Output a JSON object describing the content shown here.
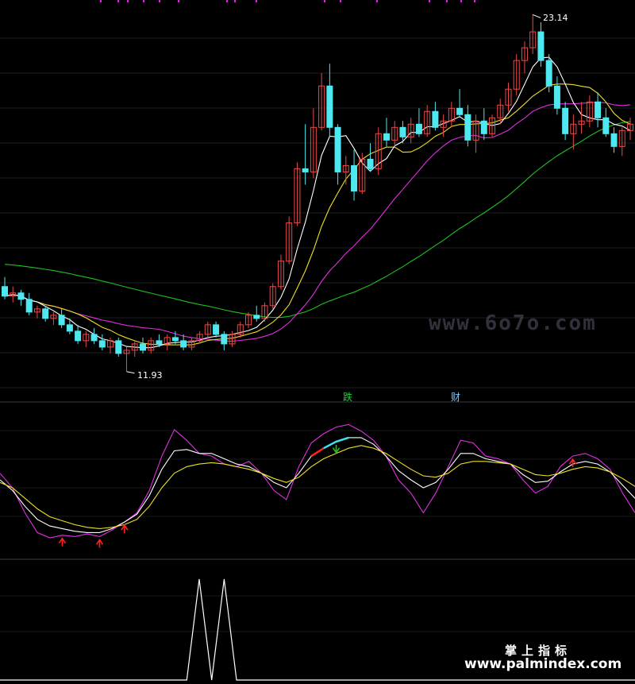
{
  "chart_data": [
    {
      "type": "candlestick",
      "annotations": {
        "high_label": "23.14",
        "low_label": "11.93",
        "event_labels": [
          "跌",
          "财"
        ]
      },
      "colors": {
        "up": "#e84a4a",
        "down": "#4fe8f0",
        "ma_fast": "#ffffff",
        "ma_mid": "#f0e020",
        "ma_slow": "#e030e0",
        "ma_long": "#20c020"
      },
      "ylim": [
        11.5,
        23.5
      ],
      "candles": [
        {
          "o": 14.6,
          "h": 14.9,
          "l": 14.2,
          "c": 14.3
        },
        {
          "o": 14.3,
          "h": 14.6,
          "l": 14.1,
          "c": 14.4
        },
        {
          "o": 14.4,
          "h": 14.5,
          "l": 14.0,
          "c": 14.2
        },
        {
          "o": 14.2,
          "h": 14.4,
          "l": 13.7,
          "c": 13.8
        },
        {
          "o": 13.8,
          "h": 14.0,
          "l": 13.6,
          "c": 13.9
        },
        {
          "o": 13.9,
          "h": 14.0,
          "l": 13.5,
          "c": 13.6
        },
        {
          "o": 13.6,
          "h": 13.8,
          "l": 13.4,
          "c": 13.7
        },
        {
          "o": 13.7,
          "h": 13.9,
          "l": 13.3,
          "c": 13.4
        },
        {
          "o": 13.4,
          "h": 13.6,
          "l": 13.1,
          "c": 13.2
        },
        {
          "o": 13.2,
          "h": 13.4,
          "l": 12.8,
          "c": 12.9
        },
        {
          "o": 12.9,
          "h": 13.2,
          "l": 12.7,
          "c": 13.1
        },
        {
          "o": 13.1,
          "h": 13.3,
          "l": 12.8,
          "c": 12.9
        },
        {
          "o": 12.9,
          "h": 13.1,
          "l": 12.6,
          "c": 12.7
        },
        {
          "o": 12.7,
          "h": 13.0,
          "l": 12.5,
          "c": 12.9
        },
        {
          "o": 12.9,
          "h": 13.0,
          "l": 12.4,
          "c": 12.5
        },
        {
          "o": 12.5,
          "h": 12.7,
          "l": 11.93,
          "c": 12.6
        },
        {
          "o": 12.6,
          "h": 12.9,
          "l": 12.4,
          "c": 12.8
        },
        {
          "o": 12.8,
          "h": 13.0,
          "l": 12.5,
          "c": 12.6
        },
        {
          "o": 12.6,
          "h": 13.0,
          "l": 12.5,
          "c": 12.9
        },
        {
          "o": 12.9,
          "h": 13.1,
          "l": 12.7,
          "c": 12.8
        },
        {
          "o": 12.8,
          "h": 13.1,
          "l": 12.6,
          "c": 13.0
        },
        {
          "o": 13.0,
          "h": 13.2,
          "l": 12.8,
          "c": 12.9
        },
        {
          "o": 12.9,
          "h": 13.1,
          "l": 12.6,
          "c": 12.7
        },
        {
          "o": 12.7,
          "h": 13.0,
          "l": 12.6,
          "c": 12.9
        },
        {
          "o": 12.9,
          "h": 13.2,
          "l": 12.8,
          "c": 13.1
        },
        {
          "o": 13.1,
          "h": 13.5,
          "l": 13.0,
          "c": 13.4
        },
        {
          "o": 13.4,
          "h": 13.5,
          "l": 13.0,
          "c": 13.1
        },
        {
          "o": 13.1,
          "h": 13.2,
          "l": 12.6,
          "c": 12.8
        },
        {
          "o": 12.8,
          "h": 13.2,
          "l": 12.7,
          "c": 13.1
        },
        {
          "o": 13.1,
          "h": 13.5,
          "l": 13.0,
          "c": 13.4
        },
        {
          "o": 13.4,
          "h": 13.8,
          "l": 13.3,
          "c": 13.7
        },
        {
          "o": 13.7,
          "h": 14.0,
          "l": 13.5,
          "c": 13.6
        },
        {
          "o": 13.6,
          "h": 14.1,
          "l": 13.5,
          "c": 14.0
        },
        {
          "o": 14.0,
          "h": 14.7,
          "l": 13.9,
          "c": 14.6
        },
        {
          "o": 14.6,
          "h": 15.6,
          "l": 14.5,
          "c": 15.4
        },
        {
          "o": 15.4,
          "h": 16.8,
          "l": 15.3,
          "c": 16.6
        },
        {
          "o": 16.6,
          "h": 18.5,
          "l": 16.5,
          "c": 18.3
        },
        {
          "o": 18.3,
          "h": 19.7,
          "l": 17.8,
          "c": 18.2
        },
        {
          "o": 18.2,
          "h": 20.2,
          "l": 18.0,
          "c": 19.6
        },
        {
          "o": 19.6,
          "h": 21.3,
          "l": 19.5,
          "c": 20.9
        },
        {
          "o": 20.9,
          "h": 21.6,
          "l": 19.3,
          "c": 19.6
        },
        {
          "o": 19.6,
          "h": 19.7,
          "l": 17.8,
          "c": 18.2
        },
        {
          "o": 18.2,
          "h": 18.7,
          "l": 17.8,
          "c": 18.4
        },
        {
          "o": 18.4,
          "h": 18.9,
          "l": 17.3,
          "c": 17.6
        },
        {
          "o": 17.6,
          "h": 18.8,
          "l": 17.5,
          "c": 18.6
        },
        {
          "o": 18.6,
          "h": 19.1,
          "l": 18.2,
          "c": 18.3
        },
        {
          "o": 18.3,
          "h": 19.6,
          "l": 18.1,
          "c": 19.4
        },
        {
          "o": 19.4,
          "h": 19.9,
          "l": 19.0,
          "c": 19.2
        },
        {
          "o": 19.2,
          "h": 19.8,
          "l": 19.0,
          "c": 19.6
        },
        {
          "o": 19.6,
          "h": 19.8,
          "l": 19.1,
          "c": 19.3
        },
        {
          "o": 19.3,
          "h": 19.9,
          "l": 19.1,
          "c": 19.7
        },
        {
          "o": 19.7,
          "h": 20.2,
          "l": 19.3,
          "c": 19.4
        },
        {
          "o": 19.4,
          "h": 20.3,
          "l": 19.3,
          "c": 20.1
        },
        {
          "o": 20.1,
          "h": 20.4,
          "l": 19.5,
          "c": 19.6
        },
        {
          "o": 19.6,
          "h": 20.0,
          "l": 19.3,
          "c": 19.8
        },
        {
          "o": 19.8,
          "h": 20.4,
          "l": 19.6,
          "c": 20.2
        },
        {
          "o": 20.2,
          "h": 20.8,
          "l": 19.9,
          "c": 20.0
        },
        {
          "o": 20.0,
          "h": 20.3,
          "l": 19.0,
          "c": 19.2
        },
        {
          "o": 19.2,
          "h": 20.0,
          "l": 18.8,
          "c": 19.8
        },
        {
          "o": 19.8,
          "h": 20.2,
          "l": 19.2,
          "c": 19.4
        },
        {
          "o": 19.4,
          "h": 20.0,
          "l": 19.3,
          "c": 19.9
        },
        {
          "o": 19.9,
          "h": 20.5,
          "l": 19.7,
          "c": 20.3
        },
        {
          "o": 20.3,
          "h": 21.0,
          "l": 20.1,
          "c": 20.8
        },
        {
          "o": 20.8,
          "h": 21.9,
          "l": 20.6,
          "c": 21.7
        },
        {
          "o": 21.7,
          "h": 22.3,
          "l": 21.3,
          "c": 22.1
        },
        {
          "o": 22.1,
          "h": 23.14,
          "l": 21.9,
          "c": 22.6
        },
        {
          "o": 22.6,
          "h": 22.9,
          "l": 21.5,
          "c": 21.7
        },
        {
          "o": 21.7,
          "h": 21.9,
          "l": 20.7,
          "c": 20.9
        },
        {
          "o": 20.9,
          "h": 21.2,
          "l": 20.0,
          "c": 20.2
        },
        {
          "o": 20.2,
          "h": 20.4,
          "l": 19.2,
          "c": 19.4
        },
        {
          "o": 19.4,
          "h": 20.0,
          "l": 18.9,
          "c": 19.7
        },
        {
          "o": 19.7,
          "h": 20.4,
          "l": 19.4,
          "c": 19.8
        },
        {
          "o": 19.8,
          "h": 20.6,
          "l": 19.6,
          "c": 20.4
        },
        {
          "o": 20.4,
          "h": 20.7,
          "l": 19.6,
          "c": 19.9
        },
        {
          "o": 19.9,
          "h": 20.2,
          "l": 19.3,
          "c": 19.4
        },
        {
          "o": 19.4,
          "h": 19.6,
          "l": 18.8,
          "c": 19.0
        },
        {
          "o": 19.0,
          "h": 19.6,
          "l": 18.7,
          "c": 19.5
        },
        {
          "o": 19.5,
          "h": 19.9,
          "l": 19.2,
          "c": 19.7
        }
      ]
    },
    {
      "type": "line",
      "panel": "oscillator",
      "ylim": [
        0,
        100
      ],
      "series": [
        {
          "color": "#e030e0",
          "values": [
            55,
            44,
            25,
            10,
            6,
            8,
            7,
            9,
            7,
            12,
            18,
            25,
            42,
            68,
            88,
            80,
            70,
            68,
            62,
            60,
            64,
            55,
            42,
            35,
            60,
            78,
            85,
            90,
            92,
            87,
            80,
            68,
            50,
            40,
            25,
            40,
            60,
            80,
            78,
            68,
            66,
            62,
            50,
            40,
            45,
            60,
            68,
            70,
            66,
            58,
            40,
            25
          ]
        },
        {
          "color": "#ffffff",
          "values": [
            50,
            42,
            30,
            20,
            15,
            13,
            11,
            10,
            10,
            13,
            18,
            24,
            38,
            58,
            72,
            73,
            70,
            70,
            66,
            62,
            60,
            55,
            48,
            44,
            55,
            68,
            74,
            79,
            82,
            82,
            77,
            68,
            57,
            50,
            44,
            48,
            58,
            70,
            70,
            66,
            64,
            62,
            54,
            48,
            49,
            56,
            62,
            64,
            62,
            56,
            46,
            36
          ]
        },
        {
          "color": "#f0e020",
          "values": [
            48,
            44,
            36,
            28,
            22,
            19,
            16,
            14,
            13,
            14,
            16,
            20,
            30,
            44,
            55,
            60,
            62,
            63,
            62,
            60,
            58,
            55,
            51,
            48,
            52,
            60,
            66,
            70,
            74,
            76,
            74,
            70,
            64,
            58,
            53,
            52,
            55,
            62,
            64,
            64,
            63,
            62,
            58,
            54,
            53,
            55,
            58,
            60,
            59,
            56,
            51,
            45
          ]
        }
      ],
      "markers": [
        {
          "type": "up-arrow",
          "color": "#ff2020",
          "index": 5
        },
        {
          "type": "up-arrow",
          "color": "#ff2020",
          "index": 8
        },
        {
          "type": "up-arrow",
          "color": "#ff2020",
          "index": 10
        },
        {
          "type": "up-arrow",
          "color": "#ff2020",
          "index": 46
        },
        {
          "type": "down-arrow",
          "color": "#20c020",
          "index": 27
        }
      ]
    },
    {
      "type": "line",
      "panel": "signal",
      "ylim": [
        0,
        1
      ],
      "series": [
        {
          "color": "#ffffff",
          "values": [
            0,
            0,
            0,
            0,
            0,
            0,
            0,
            0,
            0,
            0,
            0,
            0,
            0,
            0,
            0,
            0,
            1,
            0,
            1,
            0,
            0,
            0,
            0,
            0,
            0,
            0,
            0,
            0,
            0,
            0,
            0,
            0,
            0,
            0,
            0,
            0,
            0,
            0,
            0,
            0,
            0,
            0,
            0,
            0,
            0,
            0,
            0,
            0,
            0,
            0,
            0,
            0
          ]
        }
      ]
    }
  ],
  "watermarks": [
    "www.6o7o.com",
    "掌上指标",
    "www.palmindex.com"
  ]
}
